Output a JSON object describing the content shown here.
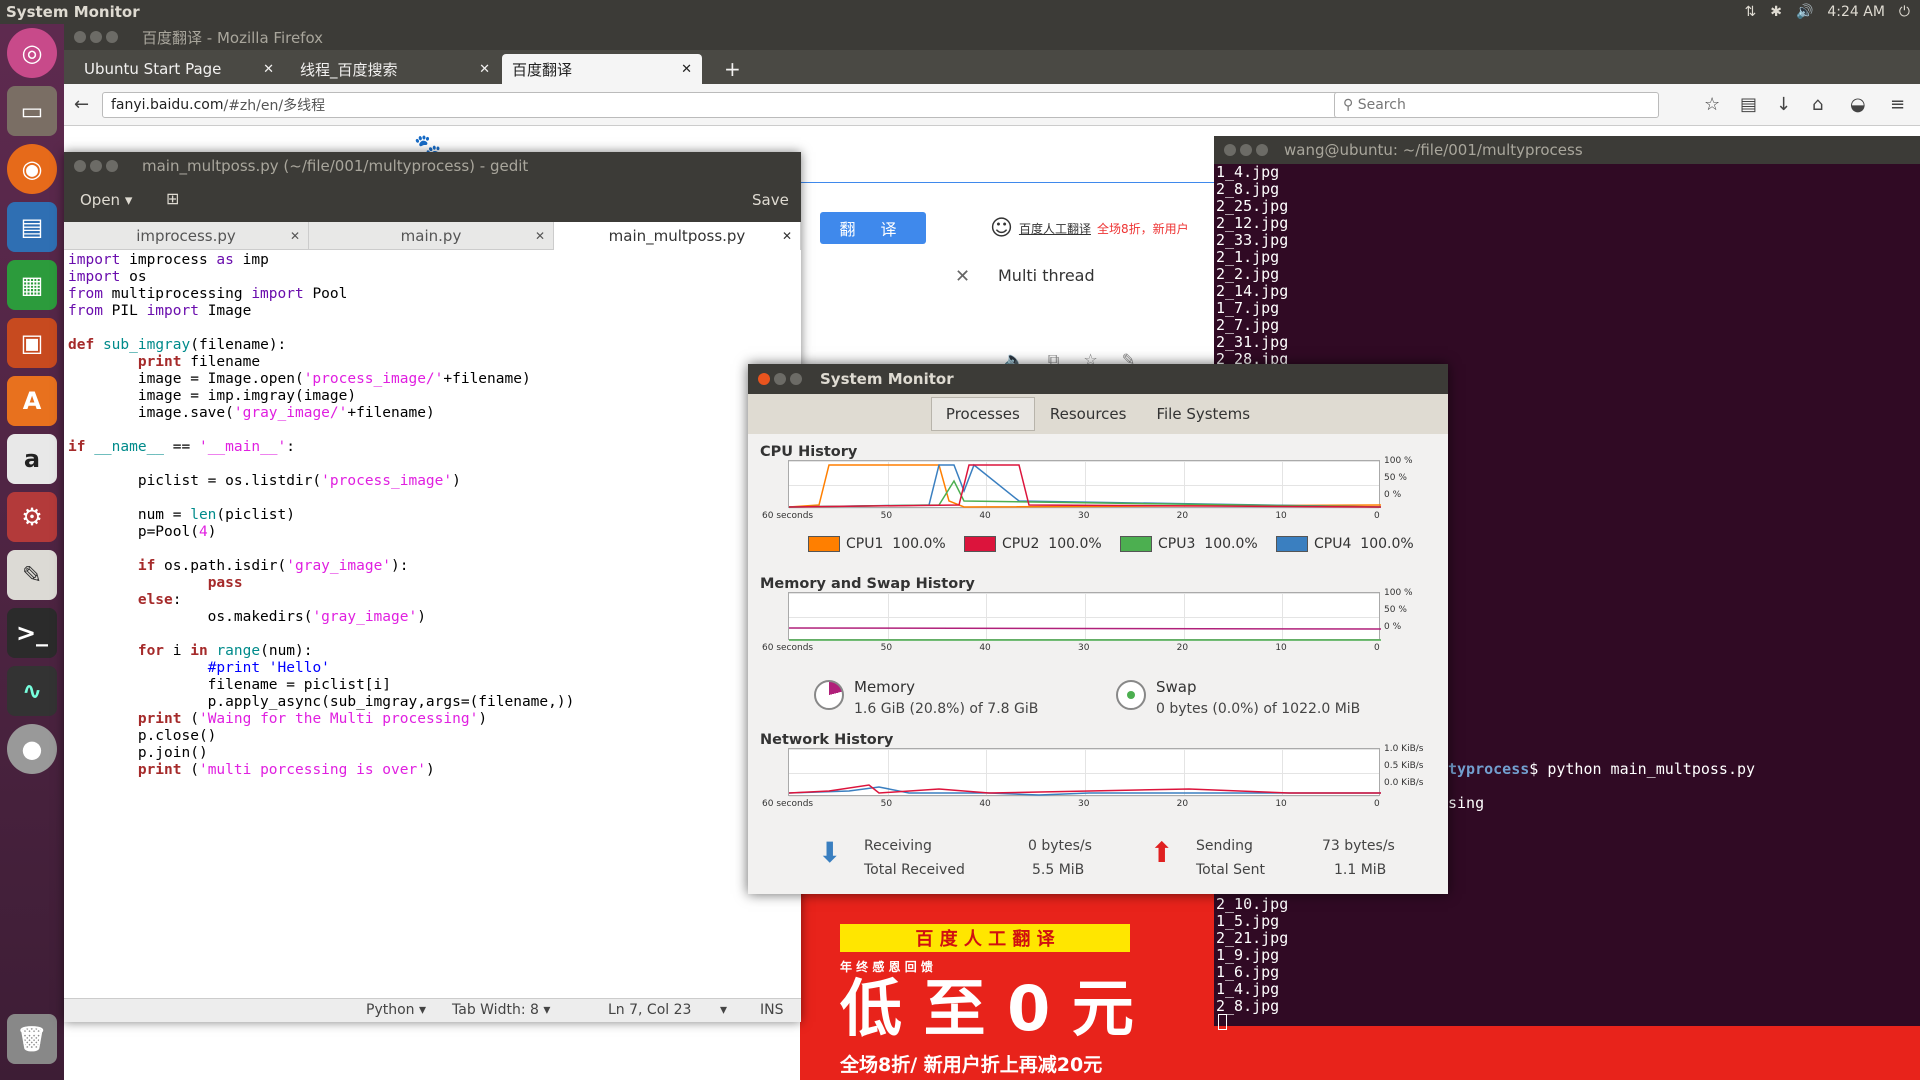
{
  "top_panel": {
    "app_title": "System Monitor",
    "time": "4:24 AM"
  },
  "launcher": [
    "ubuntu-icon",
    "files-icon",
    "firefox-icon",
    "writer-icon",
    "calc-icon",
    "impress-icon",
    "software-center-icon",
    "amazon-icon",
    "settings-icon",
    "gedit-icon",
    "terminal-icon",
    "system-monitor-icon",
    "dvd-icon",
    "trash-icon"
  ],
  "firefox": {
    "window_title": "百度翻译 - Mozilla Firefox",
    "tabs": [
      {
        "label": "Ubuntu Start Page"
      },
      {
        "label": "线程_百度搜索"
      },
      {
        "label": "百度翻译"
      }
    ],
    "url_domain": "fanyi.baidu.com",
    "url_path": "/#zh/en/多线程",
    "search_placeholder": "Search",
    "translate_button": "翻 译",
    "human_translate": "百度人工翻译",
    "promo_text": "全场8折，新用户",
    "result_text": "Multi thread",
    "banner": {
      "line1": "百 度 人 工 翻 译",
      "line2": "年 终 感 恩 回 馈",
      "big": "低 至 0 元",
      "bottom": "全场8折/ 新用户折上再减20元"
    }
  },
  "gedit": {
    "window_title": "main_multposs.py (~/file/001/multyprocess) - gedit",
    "open_label": "Open",
    "save_label": "Save",
    "tabs": [
      {
        "label": "improcess.py"
      },
      {
        "label": "main.py"
      },
      {
        "label": "main_multposs.py"
      }
    ],
    "status": {
      "lang": "Python",
      "tab_width": "Tab Width: 8",
      "position": "Ln 7, Col 23",
      "mode": "INS"
    }
  },
  "terminal": {
    "title": "wang@ubuntu: ~/file/001/multyprocess",
    "lines_top": [
      "1_4.jpg",
      "2_8.jpg",
      "2_25.jpg",
      "2_12.jpg",
      "2_33.jpg",
      "2_1.jpg",
      "2_2.jpg",
      "2_14.jpg",
      "1_7.jpg",
      "2_7.jpg",
      "2_31.jpg",
      "2_28.jpg"
    ],
    "prompt_tail": "typrocess",
    "command": "$ python main_multposs.py",
    "sing": "sing",
    "lines_bottom": [
      "2_10.jpg",
      "1_5.jpg",
      "2_21.jpg",
      "1_9.jpg",
      "1_6.jpg",
      "1_4.jpg",
      "2_8.jpg"
    ]
  },
  "sysmon": {
    "title": "System Monitor",
    "tabs": [
      {
        "label": "Processes"
      },
      {
        "label": "Resources"
      },
      {
        "label": "File Systems"
      }
    ],
    "cpu_title": "CPU History",
    "mem_title": "Memory and Swap History",
    "net_title": "Network History",
    "time_ticks": [
      "60 seconds",
      "50",
      "40",
      "30",
      "20",
      "10",
      "0"
    ],
    "pct_ticks": [
      "100 %",
      "50 %",
      "0 %"
    ],
    "net_ticks": [
      "1.0 KiB/s",
      "0.5 KiB/s",
      "0.0 KiB/s"
    ],
    "cpus": [
      {
        "label": "CPU1",
        "value": "100.0%",
        "color": "#ff7f00"
      },
      {
        "label": "CPU2",
        "value": "100.0%",
        "color": "#dc143c"
      },
      {
        "label": "CPU3",
        "value": "100.0%",
        "color": "#4caf50"
      },
      {
        "label": "CPU4",
        "value": "100.0%",
        "color": "#3a7fc0"
      }
    ],
    "memory": {
      "label": "Memory",
      "value": "1.6 GiB (20.8%) of 7.8 GiB",
      "fraction": 0.208
    },
    "swap": {
      "label": "Swap",
      "value": "0 bytes (0.0%) of 1022.0 MiB"
    },
    "net": {
      "receiving_label": "Receiving",
      "receiving": "0 bytes/s",
      "total_received_label": "Total Received",
      "total_received": "5.5 MiB",
      "sending_label": "Sending",
      "sending": "73 bytes/s",
      "total_sent_label": "Total Sent",
      "total_sent": "1.1 MiB"
    }
  }
}
